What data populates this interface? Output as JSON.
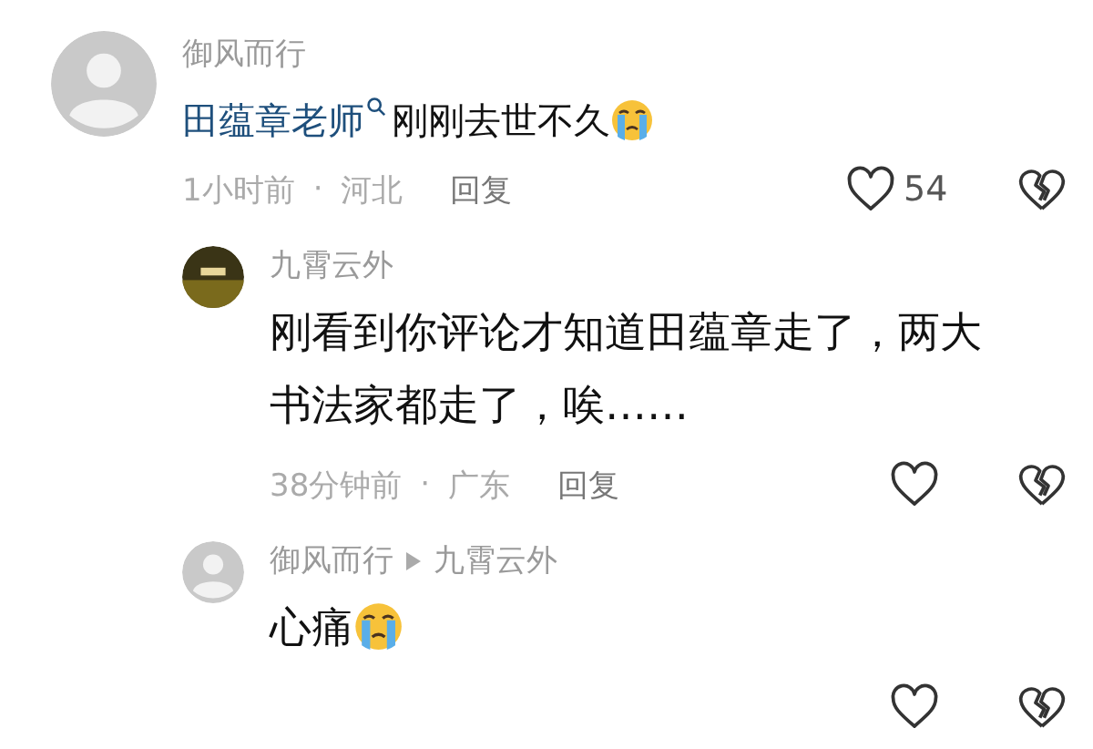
{
  "comments": [
    {
      "kind": "top",
      "photo_avatar": false,
      "name": "御风而行",
      "content": [
        {
          "kind": "mention",
          "text": "田蕴章老师"
        },
        {
          "kind": "text",
          "text": "刚刚去世不久"
        },
        {
          "kind": "emoji"
        }
      ],
      "time": "1小时前",
      "separator": "·",
      "location": "河北",
      "reply": "回复",
      "likes": "54"
    },
    {
      "kind": "reply",
      "photo_avatar": true,
      "name": "九霄云外",
      "content": [
        {
          "kind": "text",
          "text": "刚看到你评论才知道田蕴章走了，两大书法家都走了，唉……"
        }
      ],
      "time": "38分钟前",
      "separator": "·",
      "location": "广东",
      "reply": "回复"
    },
    {
      "kind": "reply",
      "photo_avatar": false,
      "name": "御风而行",
      "reply_to": "九霄云外",
      "content": [
        {
          "kind": "text",
          "text": "心痛"
        },
        {
          "kind": "emoji"
        }
      ]
    }
  ]
}
